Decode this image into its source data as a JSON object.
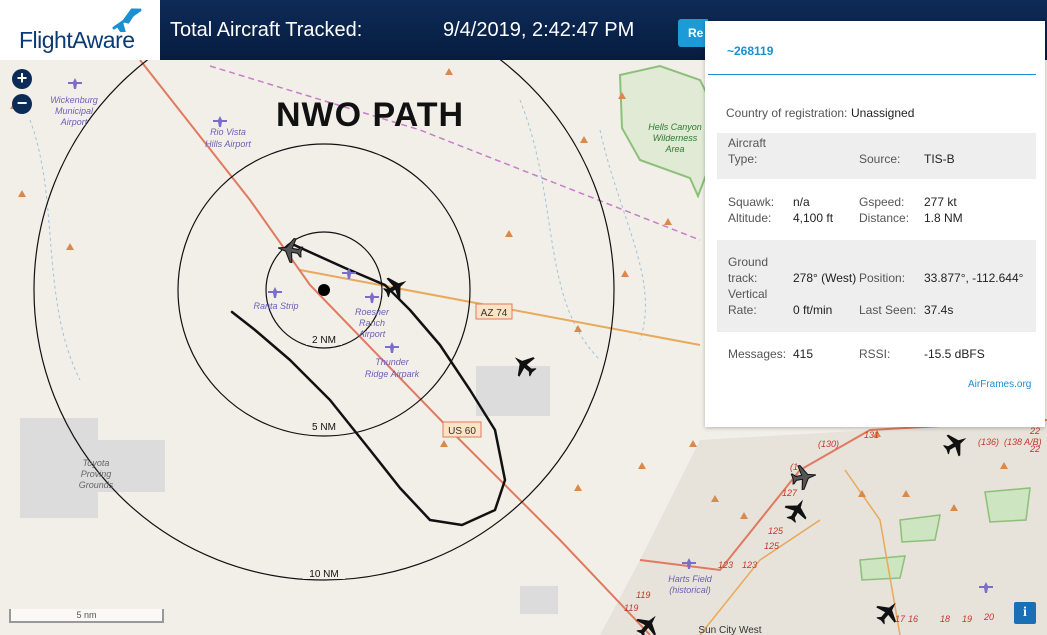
{
  "header": {
    "logo_text": "FlightAware",
    "title": "Total Aircraft Tracked:",
    "timestamp": "9/4/2019, 2:42:47 PM",
    "button_label": "Re"
  },
  "annotation": {
    "text": "NWO PATH"
  },
  "map": {
    "range_rings": [
      "2 NM",
      "5 NM",
      "10 NM"
    ],
    "places": {
      "wickenburg": "Wickenburg Municipal Airport",
      "rio_vista": "Rio Vista Hills Airport",
      "hells_canyon": "Hells Canyon Wilderness Area",
      "ranta": "Ranta Strip",
      "roesner": "Roesner Ranch Airport",
      "thunder": "Thunder Ridge Airpark",
      "toyota": "Toyota Proving Grounds",
      "harts": "Harts Field (historical)",
      "sun_city": "Sun City West"
    },
    "roads": {
      "az74": "AZ 74",
      "us60": "US 60"
    },
    "altitudes": [
      "(130)",
      "131",
      "(136)",
      "(138 A/B)",
      "127",
      "125",
      "125",
      "123",
      "123",
      "119",
      "119",
      "17",
      "16",
      "18",
      "19",
      "20",
      "22",
      "22",
      "(1"
    ],
    "scale_label": "5 nm"
  },
  "popup": {
    "callsign": "~268119",
    "country_label": "Country of registration:",
    "country_value": "Unassigned",
    "aircraft_type_label_1": "Aircraft",
    "aircraft_type_label_2": "Type:",
    "source_label": "Source:",
    "source_value": "TIS-B",
    "squawk_label": "Squawk:",
    "squawk_value": "n/a",
    "gspeed_label": "Gspeed:",
    "gspeed_value": "277 kt",
    "altitude_label": "Altitude:",
    "altitude_value": "4,100 ft",
    "distance_label": "Distance:",
    "distance_value": "1.8 NM",
    "ground_track_label_1": "Ground",
    "ground_track_label_2": "track:",
    "ground_track_value": "278° (West)",
    "position_label": "Position:",
    "position_value": "33.877°, -112.644°",
    "vertical_rate_label_1": "Vertical",
    "vertical_rate_label_2": "Rate:",
    "vertical_rate_value": "0 ft/min",
    "last_seen_label": "Last Seen:",
    "last_seen_value": "37.4s",
    "messages_label": "Messages:",
    "messages_value": "415",
    "rssi_label": "RSSI:",
    "rssi_value": "-15.5 dBFS",
    "airframes_link": "AirFrames.org"
  },
  "controls": {
    "zoom_in": "+",
    "zoom_out": "−",
    "info": "i"
  },
  "colors": {
    "header_bg": "#0d2b57",
    "accent": "#1b8fd3",
    "map_bg": "#f2efe9",
    "road_orange": "#e8a95a",
    "road_red": "#e07a5f",
    "park_green": "#6aa84f"
  }
}
